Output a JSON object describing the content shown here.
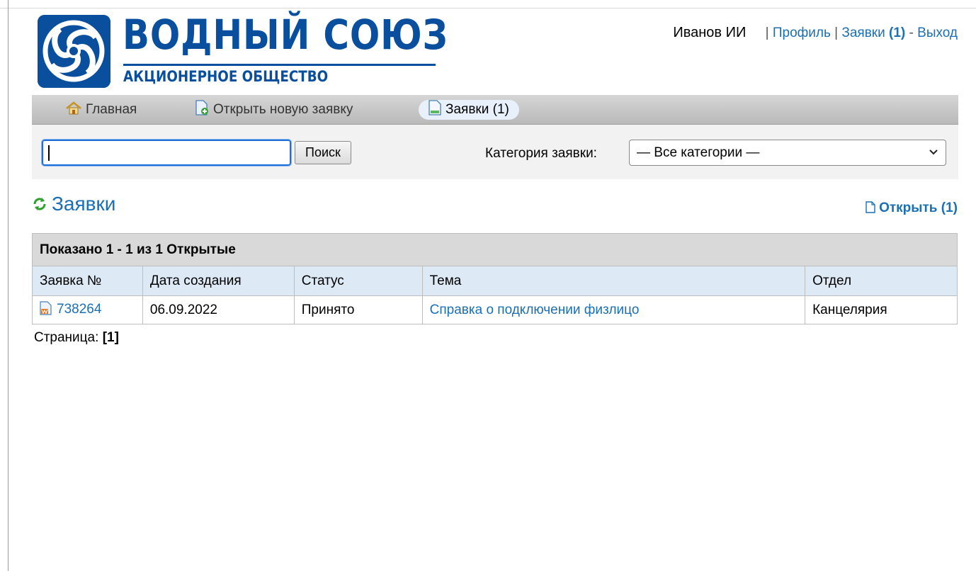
{
  "brand": {
    "title": "ВОДНЫЙ СОЮЗ",
    "subtitle": "АКЦИОНЕРНОЕ ОБЩЕСТВО",
    "color": "#0a4f9e"
  },
  "user_nav": {
    "user_name": "Иванов ИИ",
    "sep1": "|",
    "profile": "Профиль",
    "sep2": "|",
    "tickets_label": "Заявки",
    "tickets_count": "(1)",
    "dash": "-",
    "logout": "Выход"
  },
  "menu": {
    "home": "Главная",
    "new_ticket": "Открыть новую заявку",
    "tickets": "Заявки (1)"
  },
  "search": {
    "value": "",
    "placeholder": "",
    "button": "Поиск",
    "category_label": "Категория заявки:",
    "category_selected": "— Все категории —"
  },
  "page": {
    "title": "Заявки",
    "open_link": "Открыть (1)"
  },
  "table": {
    "caption": "Показано 1 - 1 из 1 Открытые",
    "headers": [
      "Заявка №",
      "Дата создания",
      "Статус",
      "Тема",
      "Отдел"
    ],
    "rows": [
      {
        "number": "738264",
        "date": "06.09.2022",
        "status": "Принято",
        "subject": "Справка о подключении физлицо",
        "department": "Канцелярия"
      }
    ]
  },
  "pager": {
    "label": "Страница:",
    "current": "[1]"
  },
  "colors": {
    "link": "#1a6fb5",
    "menu_bar": "#c8c8c8",
    "table_header": "#dde9f5",
    "refresh_icon": "#2ea02e"
  }
}
